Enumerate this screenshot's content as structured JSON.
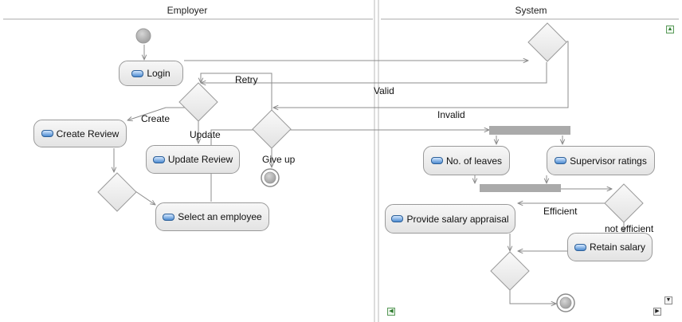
{
  "lanes": {
    "left_title": "Employer",
    "right_title": "System"
  },
  "actions": {
    "login": "Login",
    "create_review": "Create Review",
    "update_review": "Update Review",
    "select_employee": "Select an employee",
    "no_of_leaves": "No. of leaves",
    "supervisor_ratings": "Supervisor ratings",
    "provide_salary_appraisal": "Provide salary appraisal",
    "retain_salary": "Retain salary"
  },
  "edge_labels": {
    "retry": "Retry",
    "valid": "Valid",
    "create": "Create",
    "update": "Update",
    "invalid": "Invalid",
    "give_up": "Give up",
    "efficient": "Efficient",
    "not_efficient": "not efficient"
  },
  "colors": {
    "lane_divider": "#b0b0b0",
    "edge": "#8c8c8c",
    "bar": "#aaaaaa",
    "node_border": "#9a9a9a"
  },
  "icons": {
    "action": "action-pill-icon",
    "scroll_up": "triangle-up-icon",
    "scroll_down": "triangle-down-icon",
    "scroll_left": "triangle-left-icon",
    "scroll_right": "triangle-right-icon"
  }
}
